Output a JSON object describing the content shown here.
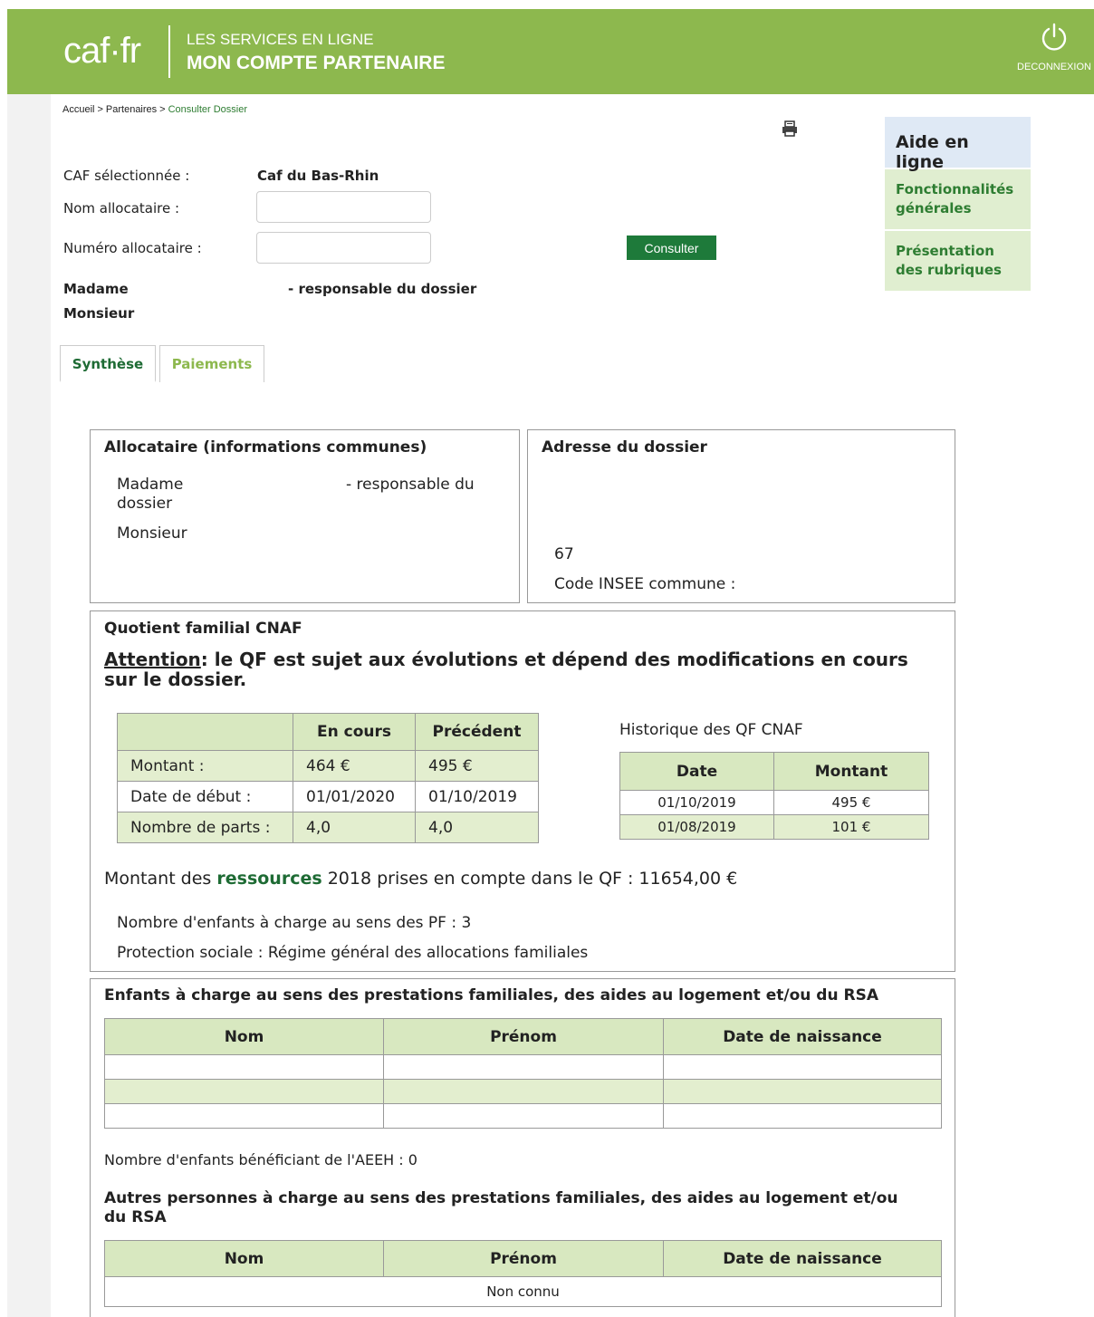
{
  "header": {
    "logo": "caf·fr",
    "line1": "LES SERVICES EN LIGNE",
    "line2": "MON COMPTE PARTENAIRE",
    "logout_label": "DECONNEXION"
  },
  "breadcrumb": {
    "items": [
      "Accueil",
      "Partenaires",
      "Consulter Dossier"
    ],
    "separator": ">"
  },
  "form": {
    "caf_label": "CAF sélectionnée :",
    "caf_value": "Caf du Bas-Rhin",
    "nom_label": "Nom allocataire :",
    "nom_value": "",
    "numero_label": "Numéro allocataire :",
    "numero_value": "",
    "consulter_label": "Consulter",
    "person1": "Madame",
    "person1_role": "- responsable du dossier",
    "person2": "Monsieur"
  },
  "tabs": [
    {
      "label": "Synthèse",
      "active": true
    },
    {
      "label": "Paiements",
      "active": false
    }
  ],
  "help": {
    "title": "Aide en ligne",
    "items": [
      "Fonctionnalités générales",
      "Présentation des rubriques"
    ]
  },
  "allocataire": {
    "title": "Allocataire (informations communes)",
    "line1_name": "Madame",
    "line1_role": "- responsable du",
    "line1_cont": "dossier",
    "line2": "Monsieur"
  },
  "adresse": {
    "title": "Adresse du dossier",
    "dept": "67",
    "insee_label": "Code INSEE commune :"
  },
  "qf": {
    "title": "Quotient familial CNAF",
    "attention_word": "Attention",
    "attention_text": ": le QF est sujet aux évolutions et dépend des modifications en cours sur le dossier.",
    "col_current": "En cours",
    "col_previous": "Précédent",
    "rows": [
      {
        "label": "Montant :",
        "current": "464 €",
        "previous": "495 €"
      },
      {
        "label": "Date de début :",
        "current": "01/01/2020",
        "previous": "01/10/2019"
      },
      {
        "label": "Nombre de parts :",
        "current": "4,0",
        "previous": "4,0"
      }
    ],
    "history_title": "Historique des QF CNAF",
    "history_col_date": "Date",
    "history_col_amount": "Montant",
    "history": [
      {
        "date": "01/10/2019",
        "amount": "495 €"
      },
      {
        "date": "01/08/2019",
        "amount": "101 €"
      }
    ],
    "resources_prefix": "Montant des ",
    "resources_link": "ressources",
    "resources_suffix": " 2018 prises en compte dans le QF : 11654,00 €",
    "children_count": "Nombre d'enfants à charge au sens des PF : 3",
    "protection": "Protection sociale : Régime général des allocations familiales"
  },
  "enfants": {
    "title": "Enfants à charge au sens des prestations familiales, des aides au logement et/ou du RSA",
    "col_nom": "Nom",
    "col_prenom": "Prénom",
    "col_naissance": "Date de naissance",
    "aeeh": "Nombre d'enfants bénéficiant de l'AEEH : 0",
    "autres_title": "Autres personnes à charge au sens des prestations familiales, des aides au logement et/ou du RSA",
    "autres_empty": "Non connu"
  }
}
